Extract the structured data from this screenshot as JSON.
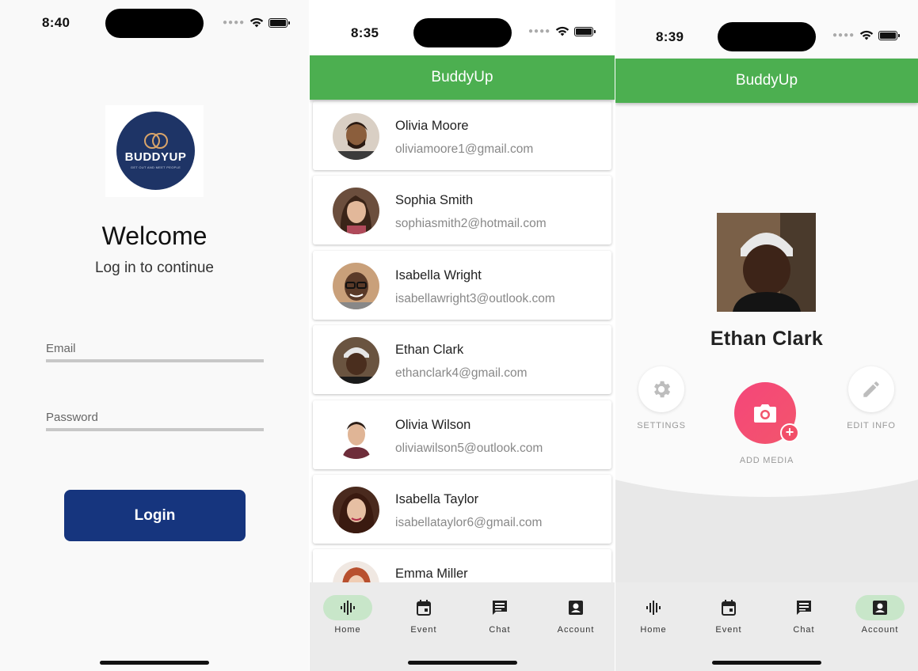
{
  "colors": {
    "brand_green": "#4caf50",
    "login_blue": "#16357e",
    "nav_active": "#c8e6c9",
    "media_pink": "#f5467a"
  },
  "login_screen": {
    "status_time": "8:40",
    "logo_text": "BUDDYUP",
    "logo_tagline": "GET OUT AND MEET PEOPLE",
    "welcome": "Welcome",
    "subtitle": "Log in to continue",
    "email_placeholder": "Email",
    "password_placeholder": "Password",
    "login_label": "Login"
  },
  "list_screen": {
    "status_time": "8:35",
    "app_title": "BuddyUp",
    "users": [
      {
        "name": "Olivia Moore",
        "email": "oliviamoore1@gmail.com"
      },
      {
        "name": "Sophia Smith",
        "email": "sophiasmith2@hotmail.com"
      },
      {
        "name": "Isabella Wright",
        "email": "isabellawright3@outlook.com"
      },
      {
        "name": "Ethan Clark",
        "email": "ethanclark4@gmail.com"
      },
      {
        "name": "Olivia Wilson",
        "email": "oliviawilson5@outlook.com"
      },
      {
        "name": "Isabella Taylor",
        "email": "isabellataylor6@gmail.com"
      },
      {
        "name": "Emma Miller",
        "email": ""
      }
    ],
    "nav": {
      "home": "Home",
      "event": "Event",
      "chat": "Chat",
      "account": "Account",
      "active": "home"
    }
  },
  "profile_screen": {
    "status_time": "8:39",
    "app_title": "BuddyUp",
    "name": "Ethan Clark",
    "settings_label": "SETTINGS",
    "add_media_label": "ADD MEDIA",
    "edit_info_label": "EDIT INFO",
    "nav": {
      "home": "Home",
      "event": "Event",
      "chat": "Chat",
      "account": "Account",
      "active": "account"
    }
  }
}
